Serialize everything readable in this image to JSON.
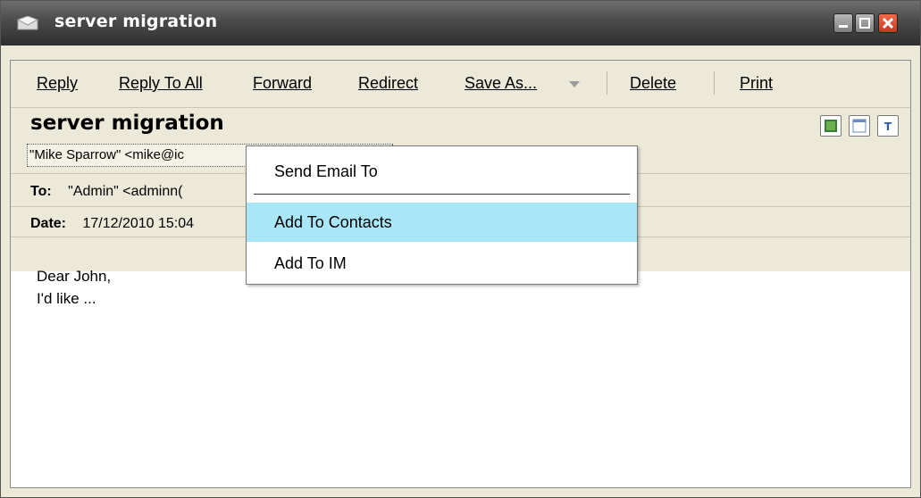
{
  "window": {
    "title": "server migration"
  },
  "toolbar": {
    "reply": "Reply",
    "reply_all": "Reply To All",
    "forward": "Forward",
    "redirect": "Redirect",
    "save_as": "Save As...",
    "delete": "Delete",
    "print": "Print"
  },
  "message": {
    "subject": "server migration",
    "from": "\"Mike Sparrow\" <mike@ic",
    "to_label": "To:",
    "to_value": "\"Admin\" <adminn(",
    "date_label": "Date:",
    "date_value": "17/12/2010 15:04",
    "body_line1": "Dear John,",
    "body_line2": "I'd like ..."
  },
  "context_menu": {
    "items": [
      "Send Email To",
      "Add To Contacts",
      "Add To IM"
    ],
    "highlighted": "Add To Contacts"
  },
  "colors": {
    "highlight": "#a9e6f7",
    "chrome": "#ece9d8"
  }
}
